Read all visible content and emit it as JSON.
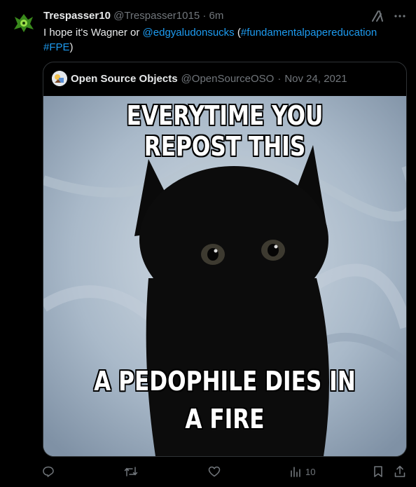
{
  "tweet": {
    "author_name": "Trespasser10",
    "author_handle": "@Trespasser1015",
    "separator": "·",
    "time": "6m",
    "text_prefix": "I hope it's Wagner or ",
    "mention": "@edgyaludonsucks",
    "text_paren_open": " (",
    "hashtag_1": "#fundamentalpapereducation",
    "hashtag_2": "#FPE",
    "text_paren_close": ")"
  },
  "quote": {
    "author_name": "Open Source Objects",
    "author_handle": "@OpenSourceOSO",
    "separator": "·",
    "date": "Nov 24, 2021",
    "meme_top_text": "EVERYTIME YOU REPOST THIS",
    "meme_bottom_line1": "A PEDOPHILE DIES IN",
    "meme_bottom_line2": "A FIRE"
  },
  "actions": {
    "views_count": "10"
  },
  "icons": {
    "grok": "grok-icon",
    "more": "more-icon",
    "reply": "reply-icon",
    "repost": "repost-icon",
    "like": "like-icon",
    "views": "views-icon",
    "bookmark": "bookmark-icon",
    "share": "share-icon"
  },
  "colors": {
    "background": "#000000",
    "text": "#e7e9ea",
    "muted": "#71767b",
    "link": "#1d9bf0",
    "border": "#2f3336"
  }
}
